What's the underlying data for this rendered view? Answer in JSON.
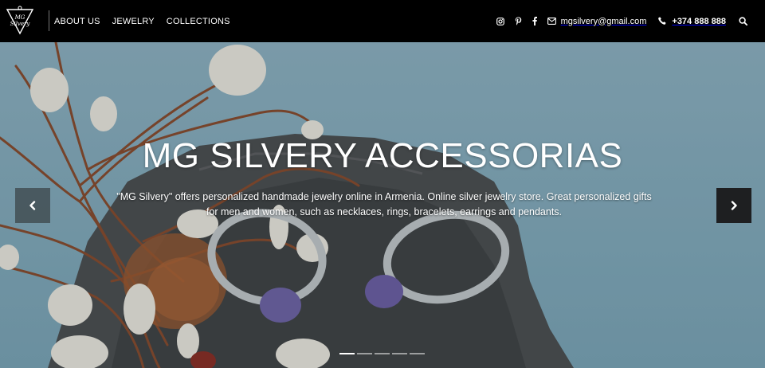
{
  "header": {
    "logo_text_line1": "MG",
    "logo_text_line2": "Silvery",
    "nav": [
      {
        "label": "ABOUT US"
      },
      {
        "label": "JEWELRY"
      },
      {
        "label": "COLLECTIONS"
      }
    ],
    "social": [
      "instagram-icon",
      "pinterest-icon",
      "facebook-icon"
    ],
    "email": "mgsilvery@gmail.com",
    "phone": "+374 888 888"
  },
  "hero": {
    "title": "MG SILVERY ACCESSORIAS",
    "description": "\"MG Silvery\" offers personalized handmade jewelry online in Armenia. Online silver jewelry store. Great personalized gifts for men and women, such as necklaces, rings, bracelets, earrings and pendants.",
    "slides_total": 5,
    "active_slide": 1
  },
  "colors": {
    "header_bg": "#000000",
    "arrow_bg": "#1e1f21",
    "sky": "#86aebf"
  }
}
